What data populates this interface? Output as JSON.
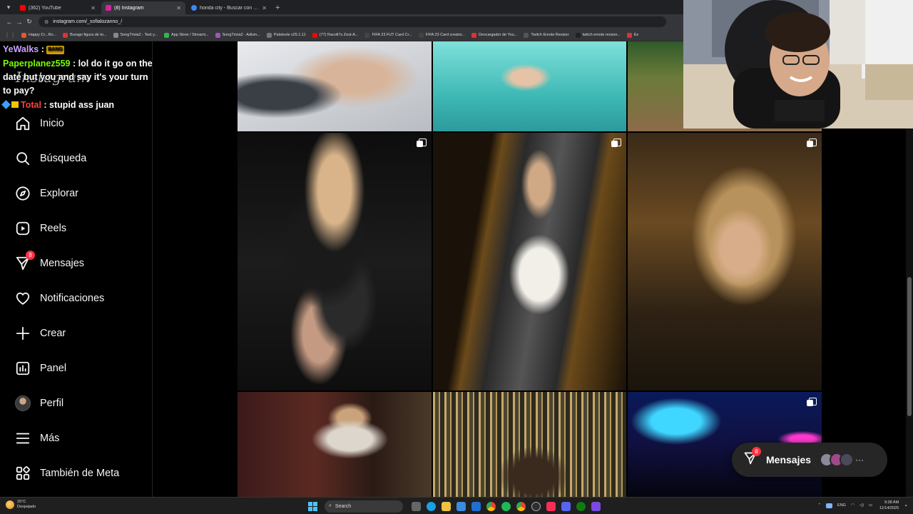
{
  "browser": {
    "tabs": [
      {
        "title": "(362) YouTube",
        "color": "#ff0000",
        "active": false
      },
      {
        "title": "(8) Instagram",
        "color": "#d6249f",
        "active": true
      },
      {
        "title": "honda city - Buscar con Google",
        "color": "#4285f4",
        "active": false
      }
    ],
    "url": "instagram.com/_sofialozanno_/",
    "bookmarks": [
      {
        "label": "Happy Cr...Ro...",
        "color": "#e05a2b"
      },
      {
        "label": "Burago figura de to...",
        "color": "#d33"
      },
      {
        "label": "SongTrivia2 - Test y...",
        "color": "#888"
      },
      {
        "label": "App Store / Streami...",
        "color": "#2db84b"
      },
      {
        "label": "SongTrivia2 - Adivin...",
        "color": "#9b59b6"
      },
      {
        "label": "Paletools v25.1.11",
        "color": "#777"
      },
      {
        "label": "(77) Racoll7s Zest-A...",
        "color": "#ff0000"
      },
      {
        "label": "FIFA 23 FUT Card Cr...",
        "color": "#444"
      },
      {
        "label": "FIFA 23 Card creator...",
        "color": "#444"
      },
      {
        "label": "Descargador de You...",
        "color": "#d33"
      },
      {
        "label": "Twitch Emote Resizer",
        "color": "#555"
      },
      {
        "label": "twitch emote resizer...",
        "color": "#222"
      },
      {
        "label": "Es",
        "color": "#d33"
      }
    ]
  },
  "chat": [
    {
      "user": "YeWalks",
      "user_color": "#c8a2ff",
      "message": "",
      "emote": "BANG"
    },
    {
      "user": "Paperplanez559",
      "user_color": "#7cfc00",
      "message": "lol do it go on the date but you and say it's your turn to pay?"
    },
    {
      "user": "Total",
      "user_color": "#ff4040",
      "message": "stupid ass juan"
    }
  ],
  "sidebar": {
    "logo": "Instagram",
    "items": [
      {
        "label": "Inicio",
        "icon": "home-icon"
      },
      {
        "label": "Búsqueda",
        "icon": "search-icon"
      },
      {
        "label": "Explorar",
        "icon": "compass-icon"
      },
      {
        "label": "Reels",
        "icon": "reels-icon"
      },
      {
        "label": "Mensajes",
        "icon": "messenger-icon",
        "badge": "8"
      },
      {
        "label": "Notificaciones",
        "icon": "heart-icon"
      },
      {
        "label": "Crear",
        "icon": "plus-icon"
      },
      {
        "label": "Panel",
        "icon": "dashboard-icon"
      },
      {
        "label": "Perfil",
        "icon": "avatar-icon"
      },
      {
        "label": "Más",
        "icon": "menu-icon"
      },
      {
        "label": "También de Meta",
        "icon": "meta-grid-icon"
      }
    ]
  },
  "messages_pill": {
    "label": "Mensajes",
    "badge": "8"
  },
  "taskbar": {
    "weather_temp": "15°C",
    "weather_desc": "Despejado",
    "search_label": "Search",
    "lang": "ENG",
    "time": "9:38 AM",
    "date": "11/14/2025"
  },
  "colors": {
    "accent": "#ff3040",
    "background": "#000000",
    "sidebar_border": "#262626"
  }
}
